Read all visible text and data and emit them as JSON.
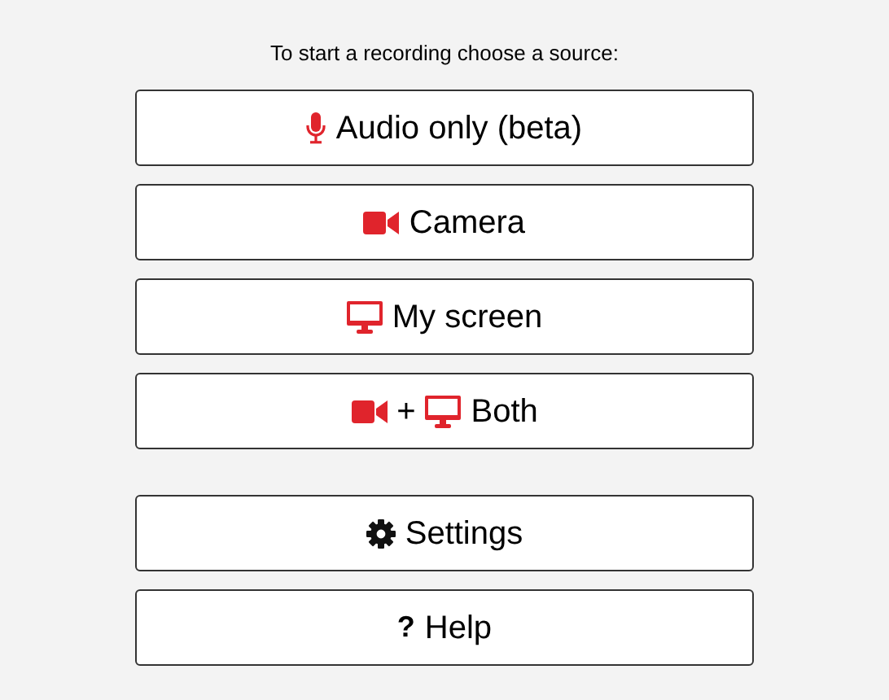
{
  "prompt": "To start a recording choose a source:",
  "sources": [
    {
      "kind": "audio",
      "label": "Audio only (beta)"
    },
    {
      "kind": "camera",
      "label": "Camera"
    },
    {
      "kind": "screen",
      "label": "My screen"
    },
    {
      "kind": "both",
      "joiner": "+",
      "label": "Both"
    }
  ],
  "actions": [
    {
      "kind": "settings",
      "label": "Settings"
    },
    {
      "kind": "help",
      "symbol": "?",
      "label": "Help"
    }
  ]
}
